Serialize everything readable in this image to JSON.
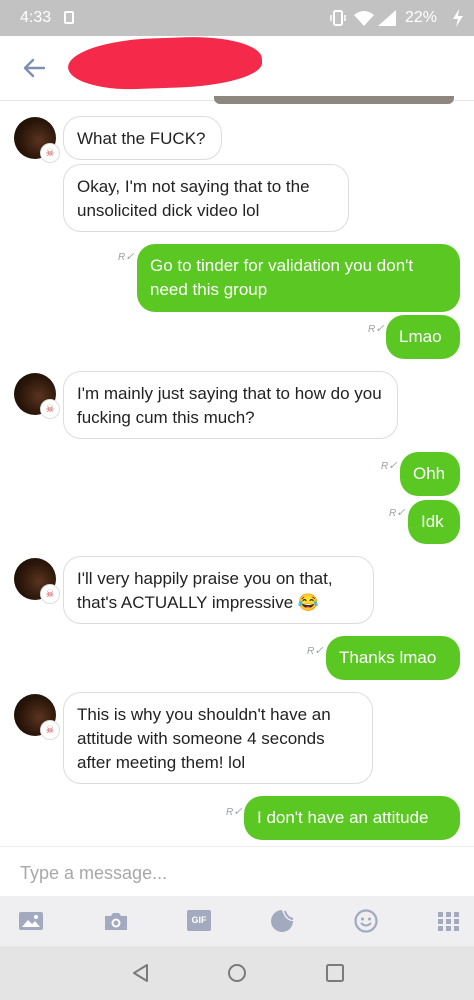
{
  "status_bar": {
    "time": "4:33",
    "battery": "22%"
  },
  "composer": {
    "placeholder": "Type a message..."
  },
  "colors": {
    "outgoing_bubble": "#5ac722",
    "incoming_bubble": "#ffffff",
    "redaction": "#f5294a"
  },
  "messages": [
    {
      "direction": "in",
      "text": "What the FUCK?"
    },
    {
      "direction": "in",
      "text": "Okay, I'm not saying that to the unsolicited dick video lol"
    },
    {
      "direction": "out",
      "text": "Go to tinder for validation you don't need this group",
      "read": "R"
    },
    {
      "direction": "out",
      "text": "Lmao",
      "read": "R"
    },
    {
      "direction": "in",
      "text": "I'm mainly just saying that to how do you fucking cum this much?"
    },
    {
      "direction": "out",
      "text": "Ohh",
      "read": "R"
    },
    {
      "direction": "out",
      "text": "Idk",
      "read": "R"
    },
    {
      "direction": "in",
      "text": "I'll very happily praise you on that, that's ACTUALLY impressive 😂"
    },
    {
      "direction": "out",
      "text": "Thanks lmao",
      "read": "R"
    },
    {
      "direction": "in",
      "text": "This is why you shouldn't have an attitude with someone 4 seconds after meeting them! lol"
    },
    {
      "direction": "out",
      "text": "I don't have an attitude",
      "read": "R"
    }
  ],
  "toolbar": {
    "gif_label": "GIF",
    "icons": [
      "gallery-icon",
      "camera-icon",
      "gif-icon",
      "sticker-icon",
      "emoji-icon",
      "apps-grid-icon"
    ]
  }
}
